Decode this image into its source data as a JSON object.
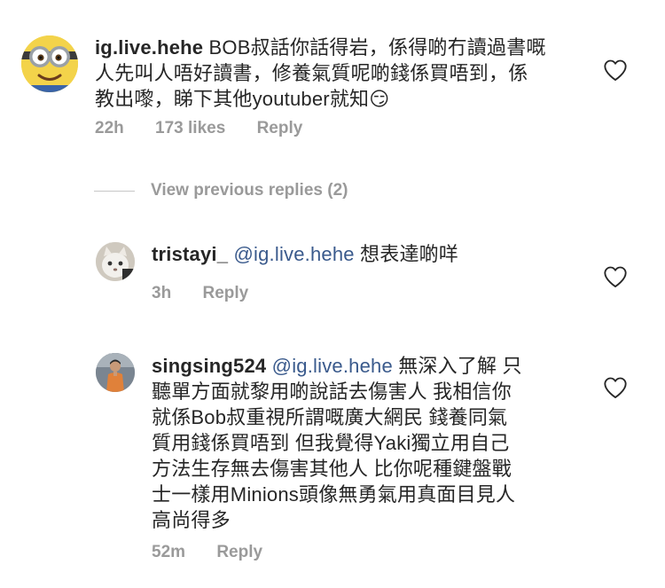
{
  "comments": [
    {
      "username": "ig.live.hehe",
      "text": "BOB叔話你話得岩，係得啲冇讀過書嘅人先叫人唔好讀書，修養氣質呢啲錢係買唔到，係教出嚟，睇下其他youtuber就知",
      "emoji": "😏",
      "time": "22h",
      "likes": "173 likes",
      "reply_label": "Reply",
      "avatar_icon": "minion-avatar"
    }
  ],
  "view_previous": "View previous replies (2)",
  "replies": [
    {
      "username": "tristayi_",
      "mention": "@ig.live.hehe",
      "text": "想表達啲咩",
      "time": "3h",
      "reply_label": "Reply",
      "avatar_icon": "cat-avatar"
    },
    {
      "username": "singsing524",
      "mention": "@ig.live.hehe",
      "text_lines": [
        "無深入了解 只",
        "聽單方面就黎用啲說話去傷害人 我相信你",
        "就係Bob叔重視所謂嘅廣大網民 錢養同氣",
        "質用錢係買唔到 但我覺得Yaki獨立用自己",
        "方法生存無去傷害其他人 比你呢種鍵盤戰",
        "士一樣用Minions頭像無勇氣用真面目見人",
        "高尚得多"
      ],
      "time": "52m",
      "reply_label": "Reply",
      "avatar_icon": "person-avatar"
    }
  ],
  "colors": {
    "text": "#262626",
    "meta": "#9a9a9a",
    "mention": "#3a5a8c",
    "divider": "#c7c7c7"
  }
}
